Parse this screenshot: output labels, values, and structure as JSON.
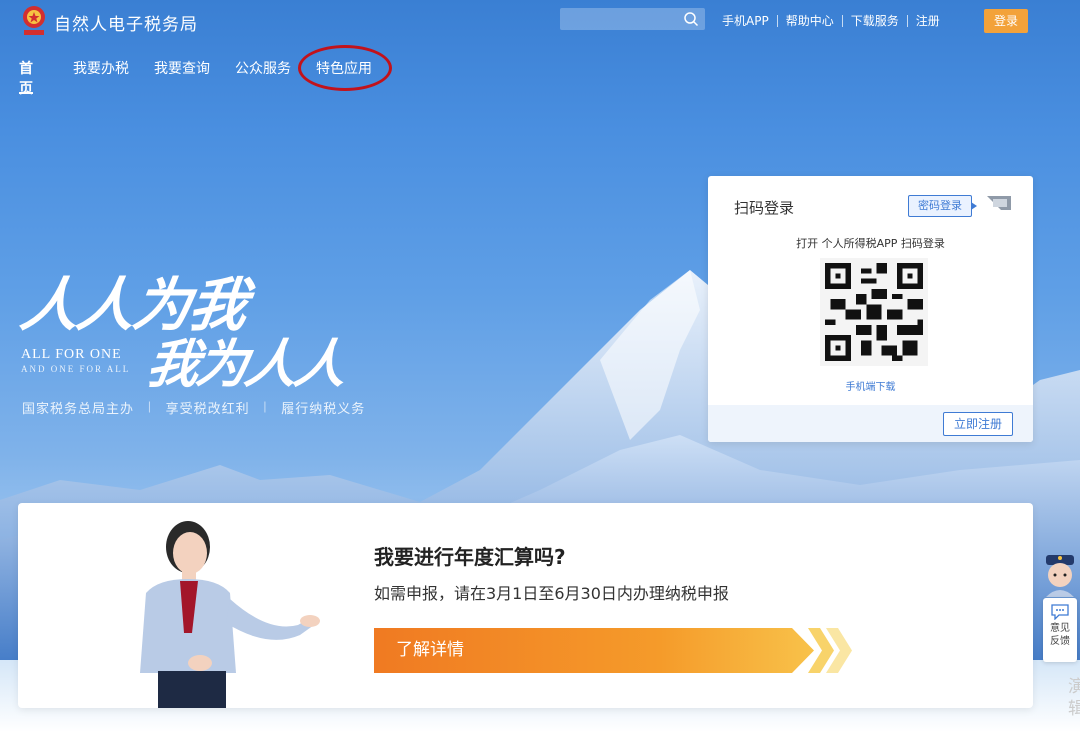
{
  "header": {
    "site_title": "自然人电子税务局",
    "search": {
      "placeholder": ""
    },
    "links": [
      "手机APP",
      "帮助中心",
      "下载服务",
      "注册"
    ],
    "login_label": "登录"
  },
  "nav": {
    "items": [
      "首页",
      "我要办税",
      "我要查询",
      "公众服务",
      "特色应用"
    ],
    "active_index": 0,
    "highlighted_index": 4
  },
  "hero": {
    "slogan_line1": "人人为我",
    "slogan_en_line1": "ALL FOR ONE",
    "slogan_en_line2": "AND ONE FOR ALL",
    "slogan_line2": "我为人人",
    "sub_slogans": [
      "国家税务总局主办",
      "享受税改红利",
      "履行纳税义务"
    ]
  },
  "login_card": {
    "title": "扫码登录",
    "switch_label": "密码登录",
    "tip": "打开 个人所得税APP 扫码登录",
    "download_link": "手机端下载",
    "register_label": "立即注册"
  },
  "banner": {
    "title": "我要进行年度汇算吗?",
    "subtitle": "如需申报，请在3月1日至6月30日内办理纳税申报",
    "cta_label": "了解详情"
  },
  "float": {
    "feedback_line1": "意见",
    "feedback_line2": "反馈",
    "edge_text": "演 辑"
  },
  "colors": {
    "accent_orange": "#f3a23a",
    "link_blue": "#3f7bd4",
    "highlight_red": "#c2121b"
  }
}
